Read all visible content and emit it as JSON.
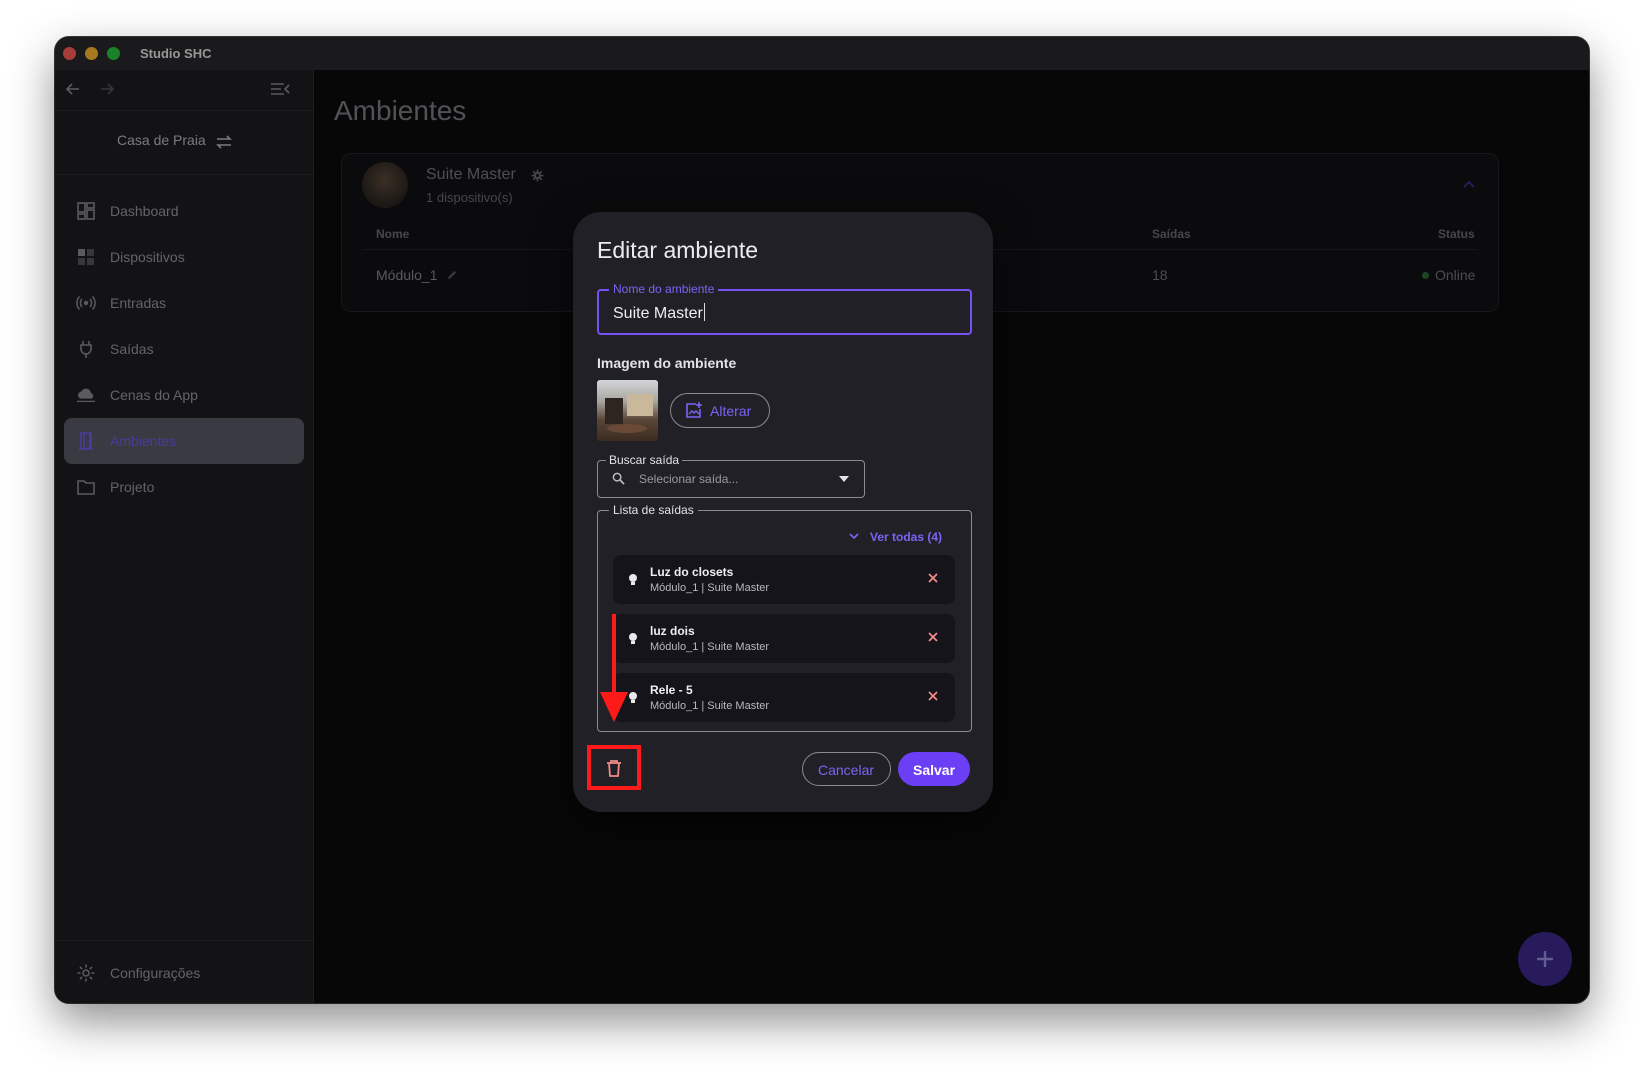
{
  "window": {
    "title": "Studio SHC"
  },
  "sidebar": {
    "house_name": "Casa de Praia",
    "items": [
      {
        "label": "Dashboard",
        "icon": "dashboard-icon"
      },
      {
        "label": "Dispositivos",
        "icon": "devices-icon"
      },
      {
        "label": "Entradas",
        "icon": "inputs-icon"
      },
      {
        "label": "Saídas",
        "icon": "plug-icon"
      },
      {
        "label": "Cenas do App",
        "icon": "cloud-icon"
      },
      {
        "label": "Ambientes",
        "icon": "door-icon",
        "active": true
      },
      {
        "label": "Projeto",
        "icon": "folder-icon"
      }
    ],
    "settings_label": "Configurações"
  },
  "main": {
    "title": "Ambientes",
    "room": {
      "name": "Suite Master",
      "devices": "1 dispositivo(s)",
      "columns": [
        "Nome",
        "Saídas",
        "Status"
      ],
      "rows": [
        {
          "name": "Módulo_1",
          "saidas": "18",
          "status": "Online"
        }
      ]
    }
  },
  "dialog": {
    "title": "Editar ambiente",
    "name_field": {
      "label": "Nome do ambiente",
      "value": "Suite Master"
    },
    "image_label": "Imagem do ambiente",
    "change_image_label": "Alterar",
    "search": {
      "label": "Buscar saída",
      "placeholder": "Selecionar saída..."
    },
    "list": {
      "label": "Lista de saídas",
      "ver_todas": "Ver todas (4)",
      "items": [
        {
          "name": "Luz do closets",
          "sub": "Módulo_1 | Suite Master"
        },
        {
          "name": "luz dois",
          "sub": "Módulo_1 | Suite Master"
        },
        {
          "name": "Rele - 5",
          "sub": "Módulo_1 | Suite Master"
        }
      ]
    },
    "cancel_label": "Cancelar",
    "save_label": "Salvar"
  },
  "colors": {
    "accent": "#6b3ff5",
    "online": "#4caf50",
    "annotation": "#ff1a1a"
  }
}
